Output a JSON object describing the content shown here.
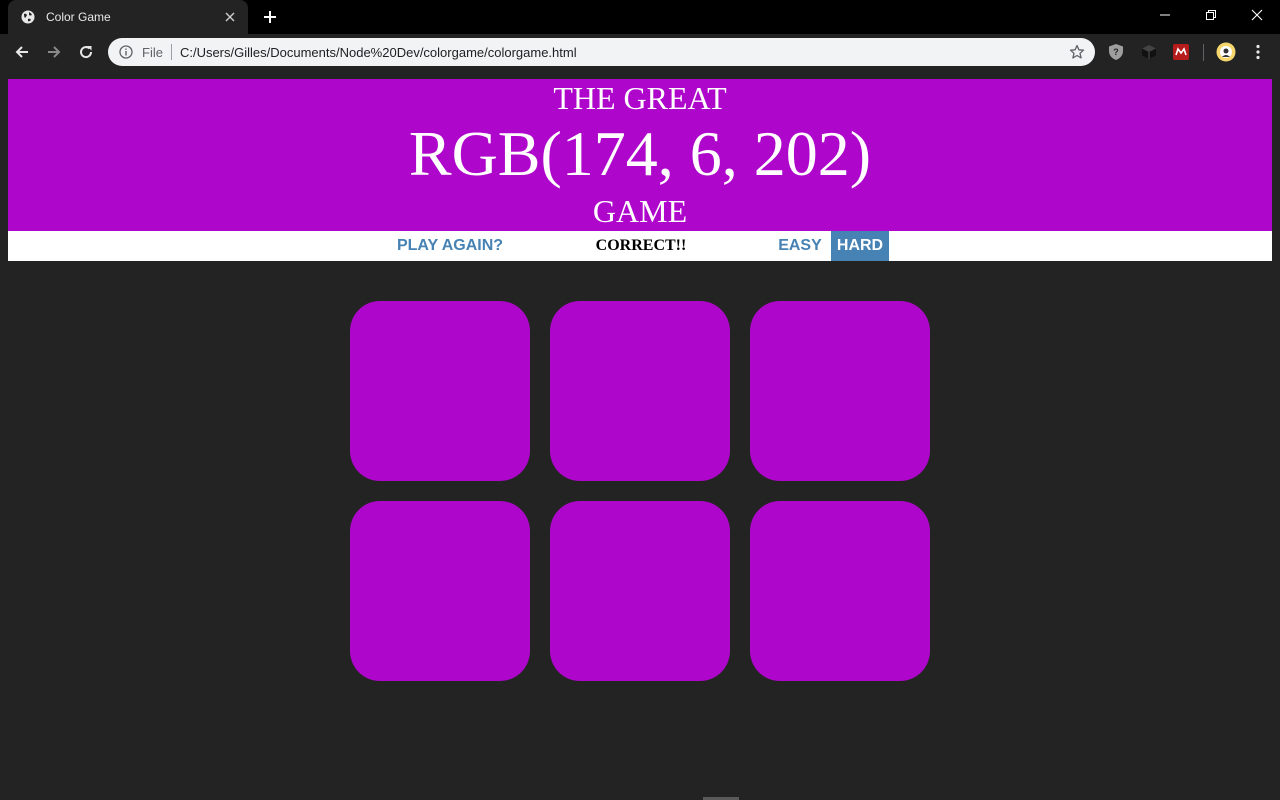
{
  "browser": {
    "tab_title": "Color Game",
    "url_scheme": "File",
    "url": "C:/Users/Gilles/Documents/Node%20Dev/colorgame/colorgame.html",
    "icons": {
      "favicon": "globe-icon",
      "tab_close": "close-icon",
      "new_tab": "plus-icon",
      "back": "back-arrow-icon",
      "forward": "forward-arrow-icon",
      "reload": "reload-icon",
      "site_info": "info-icon",
      "bookmark": "star-icon",
      "menu": "kebab-menu-icon"
    },
    "extensions": [
      "shield-extension-icon",
      "cube-extension-icon",
      "red-m-extension-icon",
      "profile-avatar-icon"
    ]
  },
  "header": {
    "line1": "THE GREAT",
    "color_display": "RGB(174, 6, 202)",
    "line3": "GAME",
    "background": "#ae06ca"
  },
  "stripe": {
    "play_again": "PLAY AGAIN?",
    "message": "CORRECT!!",
    "easy": "EASY",
    "hard": "HARD",
    "selected_mode": "HARD",
    "accent": "#4682b4"
  },
  "squares": [
    {
      "color": "#ae06ca"
    },
    {
      "color": "#ae06ca"
    },
    {
      "color": "#ae06ca"
    },
    {
      "color": "#ae06ca"
    },
    {
      "color": "#ae06ca"
    },
    {
      "color": "#ae06ca"
    }
  ],
  "page_background": "#232323"
}
